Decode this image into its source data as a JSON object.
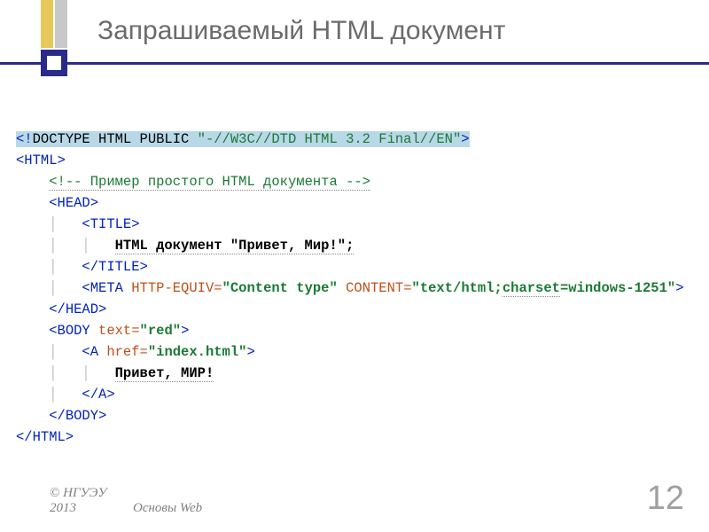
{
  "slide": {
    "title": "Запрашиваемый HTML документ"
  },
  "code": {
    "l1_a": "<!",
    "l1_b": "DOCTYPE HTML PUBLIC ",
    "l1_c": "\"-//W3C//DTD HTML 3.2 Final//EN\"",
    "l1_d": ">",
    "l2": "<HTML>",
    "l3": "<!-- Пример простого HTML документа -->",
    "l4": "<HEAD>",
    "l5": "<TITLE>",
    "l6": "HTML документ \"Привет, Мир!\";",
    "l7": "</TITLE>",
    "l8_a": "<META ",
    "l8_b": "HTTP-EQUIV=",
    "l8_c": "\"Content type\"",
    "l8_d": " CONTENT=",
    "l8_e": "\"text/html;",
    "l8_f": "charset",
    "l8_g": "=windows-1251\"",
    "l8_h": ">",
    "l9": "</HEAD>",
    "l10_a": "<BODY ",
    "l10_b": "text=",
    "l10_c": "\"red\"",
    "l10_d": ">",
    "l11_a": "<A ",
    "l11_b": "href=",
    "l11_c": "\"index.html\"",
    "l11_d": ">",
    "l12": "Привет, МИР!",
    "l13": "</A>",
    "l14": "</BODY>",
    "l15": "</HTML>",
    "indent1": "    ",
    "indent2": "    │   ",
    "indent2b": "    │   │   ",
    "guide": "│   "
  },
  "footer": {
    "org": "© НГУЭУ",
    "year": "2013",
    "topic": "Основы Web"
  },
  "page": "12"
}
